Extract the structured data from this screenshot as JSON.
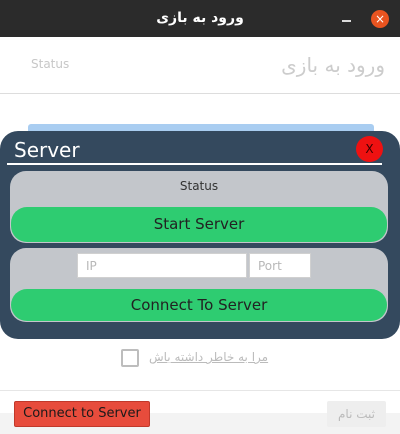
{
  "window": {
    "title": "ورود به بازی",
    "minimize_glyph": "",
    "close_glyph": "×"
  },
  "page": {
    "status_label": "Status",
    "heading": "ورود به بازی",
    "remember_label": "مرا به خاطر داشته باش",
    "connect_button": "Connect to Server",
    "register_button": "ثبت نام"
  },
  "server_dialog": {
    "title": "Server",
    "close_label": "X",
    "status_label": "Status",
    "start_button": "Start Server",
    "ip_placeholder": "IP",
    "ip_value": "",
    "port_placeholder": "Port",
    "port_value": "",
    "connect_button": "Connect To Server"
  },
  "colors": {
    "titlebar": "#2b2b2b",
    "close_button": "#e95420",
    "dialog_bg": "#34495e",
    "panel_bg": "#c3c6cb",
    "green_button": "#2ecc71",
    "red_button": "#e74c3c",
    "dialog_close": "#ee1111"
  }
}
